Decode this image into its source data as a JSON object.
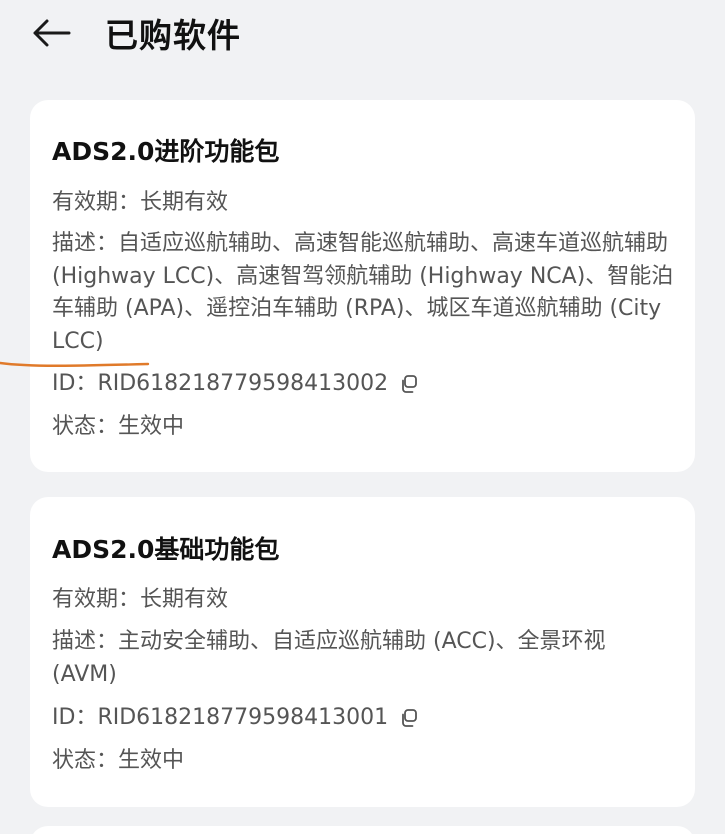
{
  "header": {
    "title": "已购软件",
    "back_icon": "arrow-left-icon"
  },
  "cards": [
    {
      "title": "ADS2.0进阶功能包",
      "validity_label": "有效期：",
      "validity_value": "长期有效",
      "desc_label": "描述：",
      "desc_value": "自适应巡航辅助、高速智能巡航辅助、高速车道巡航辅助 (Highway LCC)、高速智驾领航辅助 (Highway NCA)、智能泊车辅助 (APA)、遥控泊车辅助 (RPA)、城区车道巡航辅助 (City LCC)",
      "id_label": "ID：",
      "id_value": "RID618218779598413002",
      "status_label": "状态：",
      "status_value": "生效中"
    },
    {
      "title": "ADS2.0基础功能包",
      "validity_label": "有效期：",
      "validity_value": "长期有效",
      "desc_label": "描述：",
      "desc_value": "主动安全辅助、自适应巡航辅助 (ACC)、全景环视 (AVM)",
      "id_label": "ID：",
      "id_value": "RID618218779598413001",
      "status_label": "状态：",
      "status_value": "生效中"
    }
  ],
  "colors": {
    "background": "#f1f2f4",
    "card": "#ffffff",
    "annotation": "#e07a2a"
  }
}
